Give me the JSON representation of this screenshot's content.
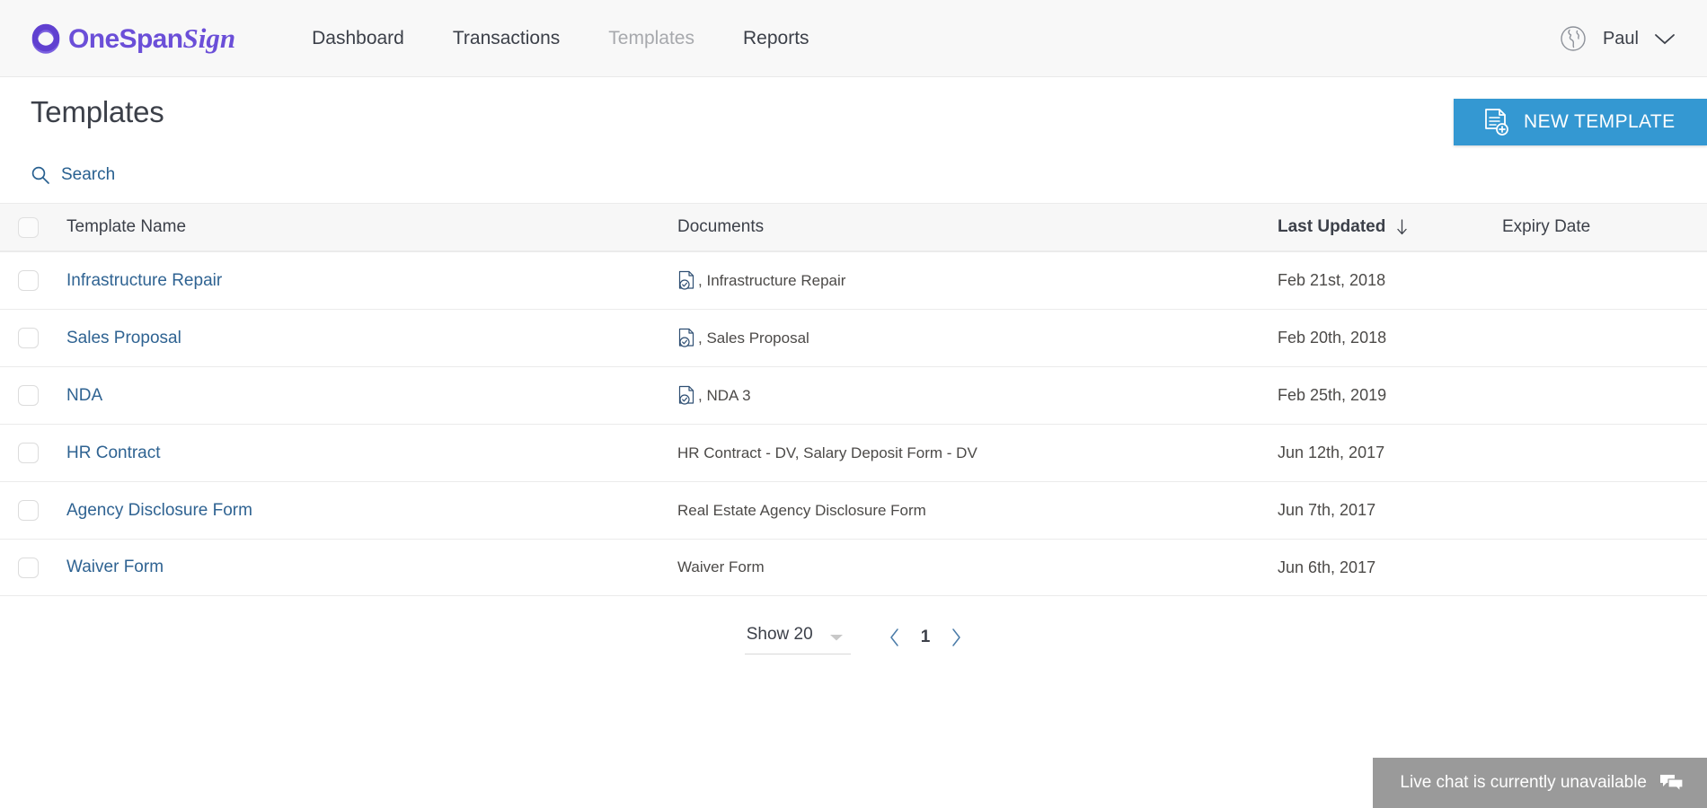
{
  "brand": {
    "name_main": "OneSpan",
    "name_script": "Sign",
    "color": "#6b4fd8",
    "logo_icon": "onespan-ring-icon"
  },
  "nav": {
    "links": [
      {
        "label": "Dashboard",
        "active": false
      },
      {
        "label": "Transactions",
        "active": false
      },
      {
        "label": "Templates",
        "active": true
      },
      {
        "label": "Reports",
        "active": false
      }
    ],
    "globe_icon": "globe-icon",
    "user": "Paul",
    "chevron_icon": "chevron-down-icon"
  },
  "page": {
    "title": "Templates",
    "new_template_label": "NEW TEMPLATE",
    "new_template_icon": "document-add-icon",
    "accent_color": "#3498d2"
  },
  "search": {
    "label": "Search",
    "icon": "search-icon",
    "color": "#286090"
  },
  "table": {
    "columns": [
      {
        "label": "Template Name",
        "sorted": false
      },
      {
        "label": "Documents",
        "sorted": false
      },
      {
        "label": "Last Updated",
        "sorted": true,
        "sort_icon": "arrow-down-icon"
      },
      {
        "label": "Expiry Date",
        "sorted": false
      }
    ],
    "rows": [
      {
        "name": "Infrastructure Repair",
        "documents": "Infrastructure Repair",
        "doc_prefix": ",",
        "has_doc_icon": true,
        "last_updated": "Feb 21st, 2018",
        "expiry_date": ""
      },
      {
        "name": "Sales Proposal",
        "documents": "Sales Proposal",
        "doc_prefix": ",",
        "has_doc_icon": true,
        "last_updated": "Feb 20th, 2018",
        "expiry_date": ""
      },
      {
        "name": "NDA",
        "documents": "NDA 3",
        "doc_prefix": ",",
        "has_doc_icon": true,
        "last_updated": "Feb 25th, 2019",
        "expiry_date": ""
      },
      {
        "name": "HR Contract",
        "documents": "HR Contract - DV, Salary Deposit Form - DV",
        "doc_prefix": "",
        "has_doc_icon": false,
        "last_updated": "Jun 12th, 2017",
        "expiry_date": ""
      },
      {
        "name": "Agency Disclosure Form",
        "documents": "Real Estate Agency Disclosure Form",
        "doc_prefix": "",
        "has_doc_icon": false,
        "last_updated": "Jun 7th, 2017",
        "expiry_date": ""
      },
      {
        "name": "Waiver Form",
        "documents": "Waiver Form",
        "doc_prefix": "",
        "has_doc_icon": false,
        "last_updated": "Jun 6th, 2017",
        "expiry_date": ""
      }
    ]
  },
  "pagination": {
    "show_label": "Show 20",
    "caret_icon": "caret-down-icon",
    "prev_icon": "chevron-left-icon",
    "next_icon": "chevron-right-icon",
    "current_page": "1"
  },
  "livechat": {
    "message": "Live chat is currently unavailable",
    "icon": "chat-bubble-icon"
  }
}
